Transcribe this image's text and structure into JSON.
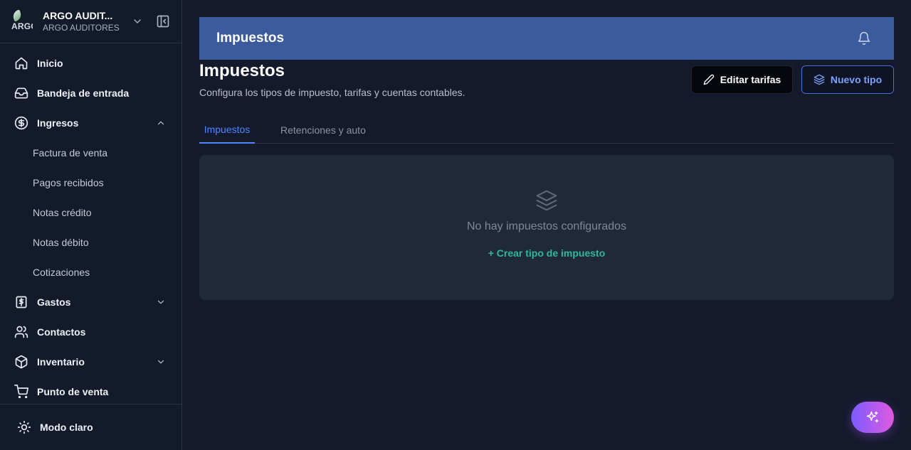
{
  "org": {
    "logo_text": "ARGO",
    "name": "ARGO AUDIT...",
    "subtitle": "ARGO AUDITORES"
  },
  "sidebar": {
    "items": [
      {
        "label": "Inicio",
        "icon": "home-icon"
      },
      {
        "label": "Bandeja de entrada",
        "icon": "inbox-icon"
      },
      {
        "label": "Ingresos",
        "icon": "dollar-circle-icon",
        "expanded": true
      },
      {
        "label": "Gastos",
        "icon": "receipt-dollar-icon",
        "expanded": false
      },
      {
        "label": "Contactos",
        "icon": "users-icon"
      },
      {
        "label": "Inventario",
        "icon": "package-icon",
        "expanded": false
      },
      {
        "label": "Punto de venta",
        "icon": "cart-icon"
      }
    ],
    "ingresos_sub": [
      {
        "label": "Factura de venta"
      },
      {
        "label": "Pagos recibidos"
      },
      {
        "label": "Notas crédito"
      },
      {
        "label": "Notas débito"
      },
      {
        "label": "Cotizaciones"
      }
    ],
    "footer": {
      "label": "Modo claro",
      "icon": "sun-icon"
    }
  },
  "header": {
    "title": "Impuestos"
  },
  "page": {
    "title": "Impuestos",
    "description": "Configura los tipos de impuesto, tarifas y cuentas contables."
  },
  "actions": {
    "edit_label": "Editar tarifas",
    "new_label": "Nuevo tipo"
  },
  "tabs": [
    {
      "label": "Impuestos",
      "active": true
    },
    {
      "label": "Retenciones y auto",
      "active": false
    }
  ],
  "empty_state": {
    "message": "No hay impuestos configurados",
    "link": "+ Crear tipo de impuesto",
    "icon": "layers-icon"
  },
  "colors": {
    "accent": "#4f86ff",
    "header_bg": "#3b5b9c",
    "link_green": "#2fb89a"
  }
}
